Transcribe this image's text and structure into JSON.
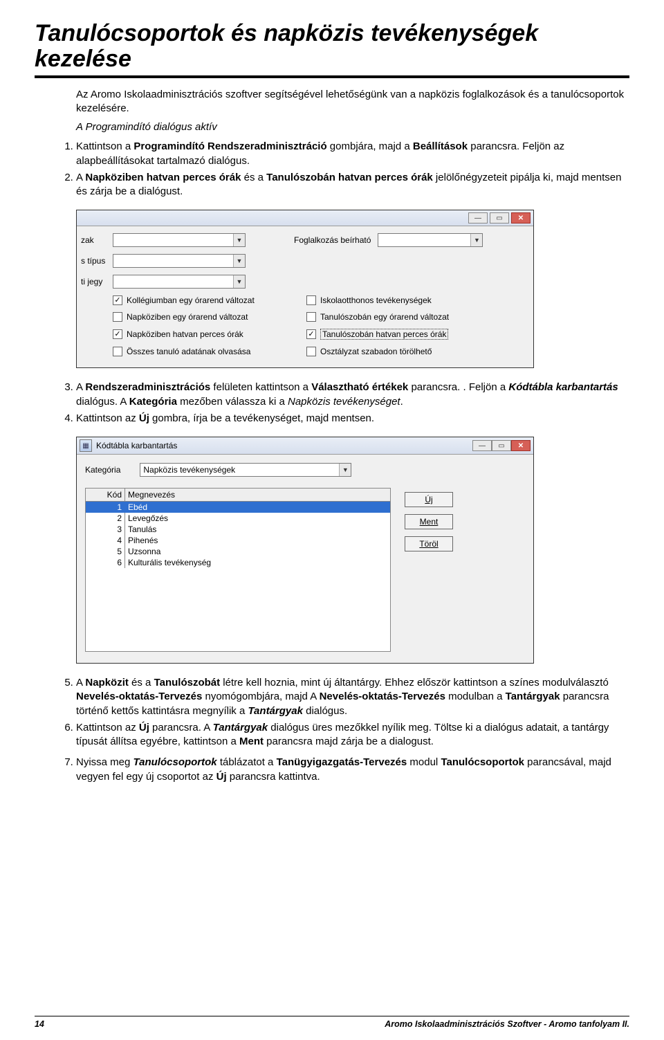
{
  "title": "Tanulócsoportok és napközis tevékenységek kezelése",
  "intro": "Az Aromo Iskolaadminisztrációs szoftver segítségével lehetőségünk van a napközis foglalkozások és a tanulócsoportok kezelésére.",
  "subhead": "A Programindító dialógus aktív",
  "steps12": {
    "s1a": "Kattintson a ",
    "s1b": "Programindító Rendszeradminisztráció",
    "s1c": " gombjára, majd a ",
    "s1d": "Beállítások",
    "s1e": " parancsra. Feljön az alapbeállításokat tartalmazó dialógus.",
    "s2a": "A ",
    "s2b": "Napköziben hatvan perces órák",
    "s2c": " és a ",
    "s2d": "Tanulószobán hatvan perces órák",
    "s2e": " jelölőnégyzeteit pipálja ki, majd mentsen és zárja be a dialógust."
  },
  "ss1": {
    "labels": {
      "l1": "zak",
      "l2": "s típus",
      "l3": "ti jegy"
    },
    "right_label": "Foglalkozás beírható",
    "checks": [
      {
        "label": "Kollégiumban egy órarend változat",
        "checked": true
      },
      {
        "label": "Iskolaotthonos tevékenységek",
        "checked": false
      },
      {
        "label": "Napköziben egy órarend változat",
        "checked": false
      },
      {
        "label": "Tanulószobán egy órarend változat",
        "checked": false
      },
      {
        "label": "Napköziben hatvan perces órák",
        "checked": true
      },
      {
        "label": "Tanulószobán hatvan perces órák",
        "checked": true,
        "boxed": true
      },
      {
        "label": "Összes tanuló adatának olvasása",
        "checked": false
      },
      {
        "label": "Osztályzat szabadon törölhető",
        "checked": false
      }
    ]
  },
  "steps34": {
    "s3a": "A ",
    "s3b": "Rendszeradminisztrációs",
    "s3c": " felületen kattintson a ",
    "s3d": "Választható értékek",
    "s3e": " parancsra. . Feljön a ",
    "s3f": "Kódtábla karbantartás",
    "s3g": " dialógus. A ",
    "s3h": "Kategória",
    "s3i": " mezőben válassza ki a ",
    "s3j": "Napközis tevékenységet",
    "s3k": ".",
    "s4a": "Kattintson az ",
    "s4b": "Új",
    "s4c": " gombra, írja be a tevékenységet, majd mentsen."
  },
  "ss2": {
    "window_title": "Kódtábla karbantartás",
    "category_label": "Kategória",
    "category_value": "Napközis tevékenységek",
    "columns": {
      "c1": "Kód",
      "c2": "Megnevezés"
    },
    "rows": [
      {
        "kod": "1",
        "name": "Ebéd",
        "selected": true
      },
      {
        "kod": "2",
        "name": "Levegőzés"
      },
      {
        "kod": "3",
        "name": "Tanulás"
      },
      {
        "kod": "4",
        "name": "Pihenés"
      },
      {
        "kod": "5",
        "name": "Uzsonna"
      },
      {
        "kod": "6",
        "name": "Kulturális tevékenység"
      }
    ],
    "buttons": {
      "uj": "Új",
      "ment": "Ment",
      "torol": "Töröl"
    }
  },
  "steps567": {
    "s5a": "A ",
    "s5b": "Napközit",
    "s5c": " és a ",
    "s5d": "Tanulószobát",
    "s5e": " létre kell hoznia, mint új áltantárgy. Ehhez először kattintson a színes modulválasztó ",
    "s5f": "Nevelés-oktatás-Tervezés",
    "s5g": " nyomógombjára, majd A ",
    "s5h": "Nevelés-oktatás-Tervezés",
    "s5i": " modulban a ",
    "s5j": "Tantárgyak",
    "s5k": " parancsra történő kettős kattintásra megnyílik a ",
    "s5l": "Tantárgyak",
    "s5m": " dialógus.",
    "s6a": "Kattintson az ",
    "s6b": "Új",
    "s6c": " parancsra. A ",
    "s6d": "Tantárgyak",
    "s6e": " dialógus üres mezőkkel nyílik meg. Töltse ki a dialógus adatait, a tantárgy típusát állítsa egyébre,  kattintson a ",
    "s6f": "Ment",
    "s6g": " parancsra majd zárja be a dialogust.",
    "s7a": " Nyissa meg ",
    "s7b": "Tanulócsoportok",
    "s7c": " táblázatot a ",
    "s7d": "Tanügyigazgatás-Tervezés",
    "s7e": " modul ",
    "s7f": "Tanulócsoportok",
    "s7g": " parancsával, majd vegyen fel egy új csoportot az ",
    "s7h": "Új",
    "s7i": " parancsra kattintva."
  },
  "footer": {
    "page": "14",
    "text": "Aromo Iskolaadminisztrációs Szoftver - Aromo tanfolyam II."
  }
}
